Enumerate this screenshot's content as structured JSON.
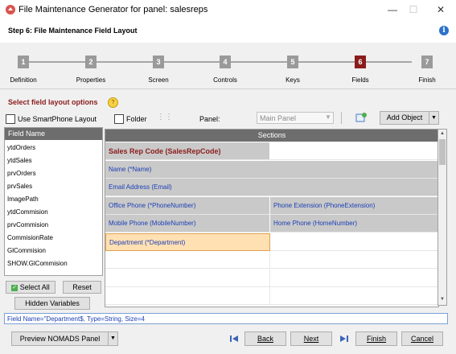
{
  "window": {
    "title": "File Maintenance Generator for panel: salesreps",
    "minimize": "—",
    "maximize": "☐",
    "close": "✕"
  },
  "header": {
    "step_title": "Step 6: File Maintenance Field Layout",
    "info": "i"
  },
  "steps": [
    {
      "num": "1",
      "label": "Definition"
    },
    {
      "num": "2",
      "label": "Properties"
    },
    {
      "num": "3",
      "label": "Screen"
    },
    {
      "num": "4",
      "label": "Controls"
    },
    {
      "num": "5",
      "label": "Keys"
    },
    {
      "num": "6",
      "label": "Fields"
    },
    {
      "num": "7",
      "label": "Finish"
    }
  ],
  "active_step": "6",
  "options": {
    "title": "Select field layout options",
    "smartphone_label": "Use SmartPhone Layout",
    "folder_label": "Folder",
    "panel_label": "Panel:",
    "panel_value": "Main Panel",
    "add_object": "Add Object"
  },
  "field_list": {
    "header": "Field Name",
    "items": [
      "ytdOrders",
      "ytdSales",
      "prvOrders",
      "prvSales",
      "ImagePath",
      "ytdCommision",
      "prvCommision",
      "CommisionRate",
      "GlCommision",
      "SHOW.GlCommision"
    ]
  },
  "field_buttons": {
    "select_all": "Select All",
    "reset": "Reset",
    "hidden_variables": "Hidden Variables"
  },
  "sections": {
    "header": "Sections",
    "rows": [
      {
        "left": "Sales Rep Code (SalesRepCode)",
        "right": ""
      },
      {
        "left": "Name (*Name)",
        "right": null
      },
      {
        "left": "Email Address (Email)",
        "right": null
      },
      {
        "left": "Office Phone (*PhoneNumber)",
        "right": "Phone Extension (PhoneExtension)"
      },
      {
        "left": "Mobile Phone (MobileNumber)",
        "right": "Home Phone (HomeNumber)"
      },
      {
        "left": "Department (*Department)",
        "right": ""
      }
    ]
  },
  "status_line": "Field Name=\"Department$,  Type=String,  Size=4",
  "footer": {
    "preview": "Preview NOMADS Panel",
    "back": "Back",
    "next": "Next",
    "finish": "Finish",
    "cancel": "Cancel"
  },
  "colors": {
    "accent": "#8b1c1c",
    "link_blue": "#1c3fb5",
    "section_gray": "#c9c9c9",
    "selected_cell": "#ffe0b3"
  }
}
